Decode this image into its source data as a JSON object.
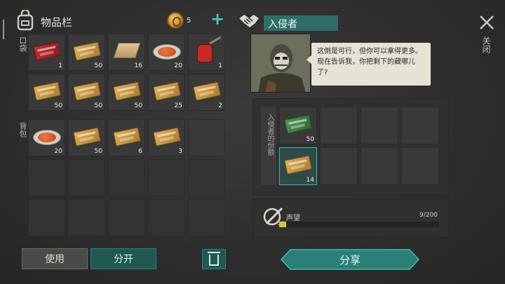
{
  "inventory": {
    "title": "物品栏",
    "coins": "5",
    "add_symbol": "+",
    "pocket_label": "口袋",
    "backpack_label": "背包",
    "pocket_rows": [
      [
        {
          "item": "coupon-red",
          "count": "1"
        },
        {
          "item": "coupon-gold",
          "count": "50"
        },
        {
          "item": "wood-plank",
          "count": "16"
        },
        {
          "item": "food-dish",
          "count": "20"
        },
        {
          "item": "oil-can",
          "count": "1"
        }
      ],
      [
        {
          "item": "coupon-gold",
          "count": "50"
        },
        {
          "item": "coupon-gold",
          "count": "50"
        },
        {
          "item": "coupon-gold",
          "count": "50"
        },
        {
          "item": "coupon-gold",
          "count": "25"
        },
        {
          "item": "coupon-gold",
          "count": "2"
        }
      ]
    ],
    "backpack_rows": [
      [
        {
          "item": "food-dish",
          "count": "20"
        },
        {
          "item": "coupon-gold",
          "count": "50"
        },
        {
          "item": "coupon-gold",
          "count": "6"
        },
        {
          "item": "coupon-gold",
          "count": "3"
        },
        {
          "item": "",
          "count": ""
        }
      ]
    ]
  },
  "actions": {
    "use": "使用",
    "split": "分开"
  },
  "intruder": {
    "name": "入侵者",
    "speech": "这倒是可行，但你可以拿得更多。现在告诉我，你把剩下的藏哪儿了?",
    "share_label": "入侵者的份额",
    "share_slots": [
      {
        "item": "coupon-green",
        "count": "50"
      },
      {
        "item": "coupon-gold",
        "count": "14"
      }
    ]
  },
  "reputation": {
    "label": "声望",
    "value": "9/200",
    "fraction": 0.045
  },
  "share_button": "分享",
  "close_label": "关闭",
  "colors": {
    "accent": "#43c8b6",
    "teal_button": "#205954",
    "rep_fill": "#e0c040"
  }
}
